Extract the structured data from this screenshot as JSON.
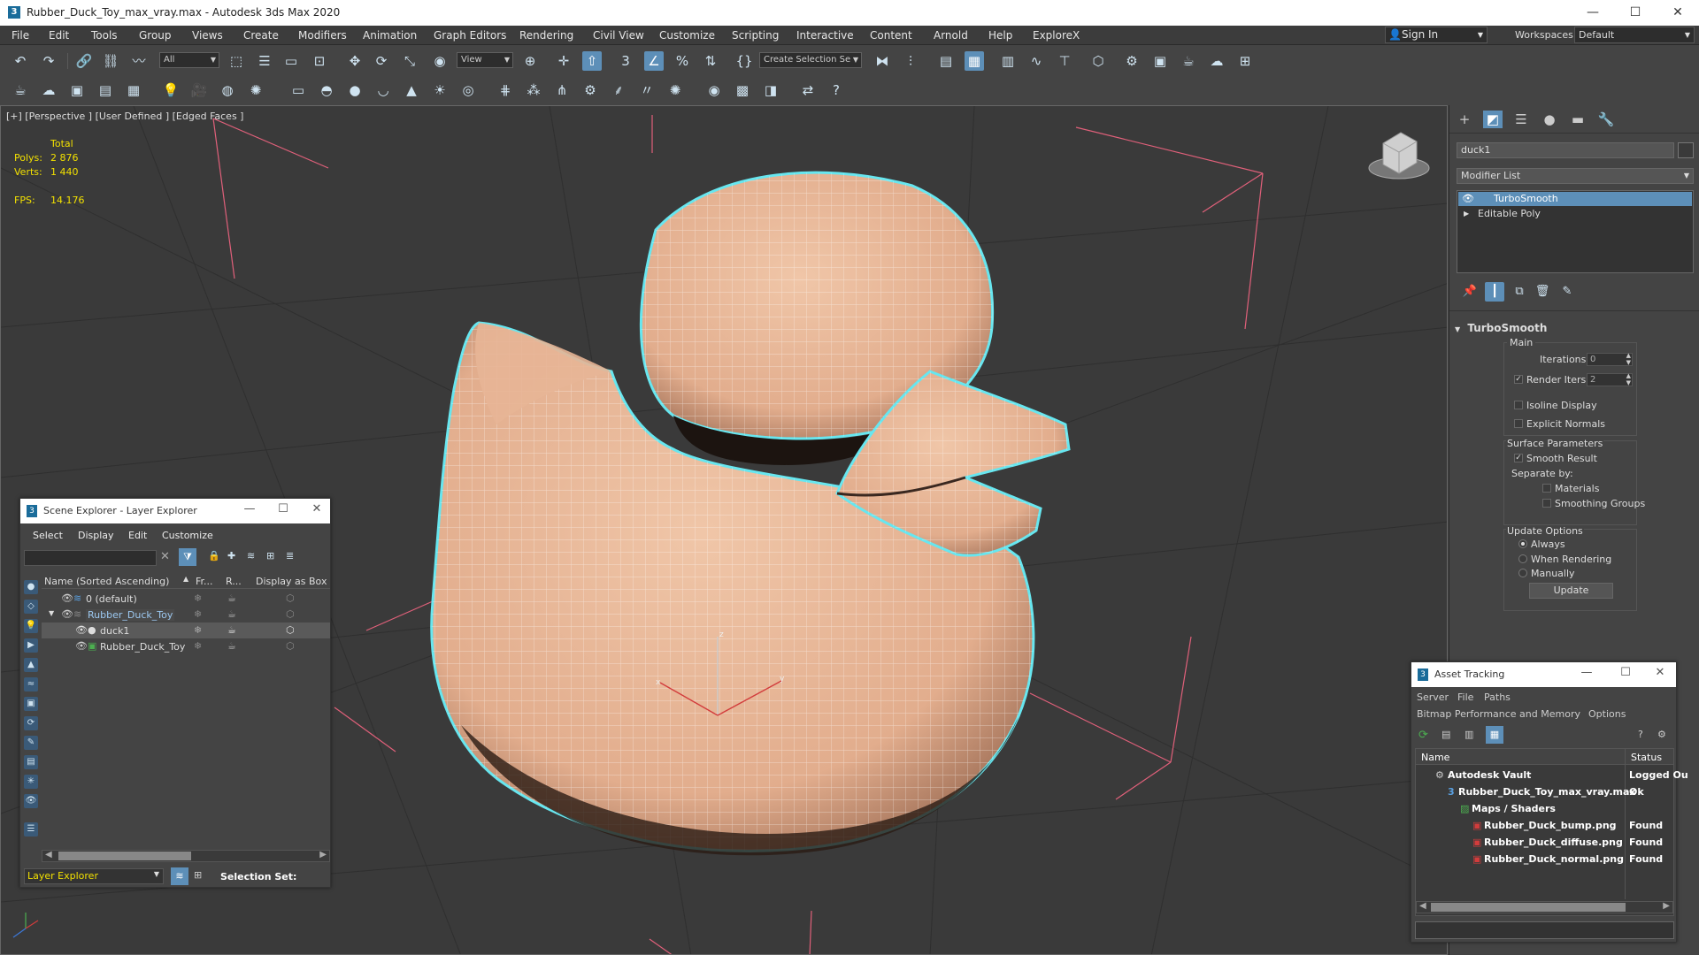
{
  "window": {
    "icon_glyph": "3",
    "title": "Rubber_Duck_Toy_max_vray.max - Autodesk 3ds Max 2020",
    "minimize_glyph": "—",
    "maximize_glyph": "☐",
    "close_glyph": "✕"
  },
  "menubar": {
    "items": [
      "File",
      "Edit",
      "Tools",
      "Group",
      "Views",
      "Create",
      "Modifiers",
      "Animation",
      "Graph Editors",
      "Rendering",
      "Civil View",
      "Customize",
      "Scripting",
      "Interactive",
      "Content",
      "Arnold",
      "Help",
      "ExploreX"
    ],
    "sign_in": "Sign In",
    "workspaces_label": "Workspaces:",
    "workspace_value": "Default"
  },
  "toolbar": {
    "selection_filter": "All",
    "ref_coord": "View",
    "create_selection_set": "Create Selection Se"
  },
  "viewport": {
    "label": "[+] [Perspective ] [User Defined ] [Edged Faces ]",
    "stats": {
      "total_label": "Total",
      "polys_label": "Polys:",
      "polys_value": "2 876",
      "verts_label": "Verts:",
      "verts_value": "1 440",
      "fps_label": "FPS:",
      "fps_value": "14.176"
    },
    "gizmo_labels": {
      "x": "x",
      "y": "y",
      "z": "z"
    },
    "colors": {
      "background": "#3a3a3a",
      "duck": "#e8b89a",
      "selection_outline": "#67e6ef",
      "grid": "#2f2f2f",
      "bbox": "#e0607a"
    }
  },
  "command_panel": {
    "object_name": "duck1",
    "modifier_list": "Modifier List",
    "stack": [
      "TurboSmooth",
      "Editable Poly"
    ],
    "turbosmooth": {
      "title": "TurboSmooth",
      "main_label": "Main",
      "iterations_label": "Iterations:",
      "iterations_value": "0",
      "render_iters_label": "Render Iters:",
      "render_iters_value": "2",
      "isoline_display": "Isoline Display",
      "explicit_normals": "Explicit Normals",
      "surface_parameters": "Surface Parameters",
      "smooth_result": "Smooth Result",
      "separate_by": "Separate by:",
      "materials": "Materials",
      "smoothing_groups": "Smoothing Groups",
      "update_options": "Update Options",
      "always": "Always",
      "when_rendering": "When Rendering",
      "manually": "Manually",
      "update_button": "Update"
    }
  },
  "scene_explorer": {
    "title": "Scene Explorer - Layer Explorer",
    "menus": [
      "Select",
      "Display",
      "Edit",
      "Customize"
    ],
    "columns": [
      "Name (Sorted Ascending)",
      "Fr...",
      "R...",
      "Display as Box"
    ],
    "rows": [
      {
        "name": "0 (default)"
      },
      {
        "name": "Rubber_Duck_Toy"
      },
      {
        "name": "duck1"
      },
      {
        "name": "Rubber_Duck_Toy"
      }
    ],
    "footer_dropdown": "Layer Explorer",
    "selection_set_label": "Selection Set:"
  },
  "asset_tracking": {
    "title": "Asset Tracking",
    "menus_row1": [
      "Server",
      "File",
      "Paths"
    ],
    "menus_row2": [
      "Bitmap Performance and Memory",
      "Options"
    ],
    "columns": [
      "Name",
      "Status"
    ],
    "rows": [
      {
        "name": "Autodesk Vault",
        "status": "Logged Ou"
      },
      {
        "name": "Rubber_Duck_Toy_max_vray.max",
        "status": "Ok"
      },
      {
        "name": "Maps / Shaders",
        "status": ""
      },
      {
        "name": "Rubber_Duck_bump.png",
        "status": "Found"
      },
      {
        "name": "Rubber_Duck_diffuse.png",
        "status": "Found"
      },
      {
        "name": "Rubber_Duck_normal.png",
        "status": "Found"
      }
    ]
  }
}
